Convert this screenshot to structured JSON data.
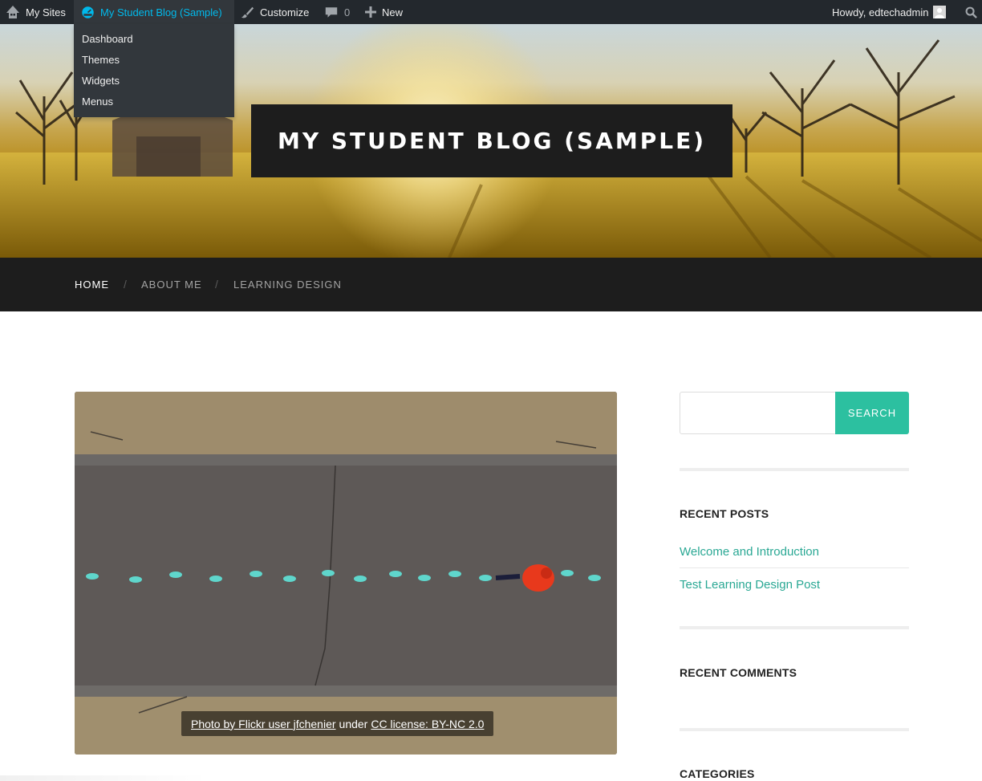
{
  "adminbar": {
    "my_sites": "My Sites",
    "site_name": "My Student Blog (Sample)",
    "customize": "Customize",
    "comments_count": "0",
    "new": "New",
    "howdy": "Howdy, edtechadmin",
    "dropdown": [
      "Dashboard",
      "Themes",
      "Widgets",
      "Menus"
    ],
    "active_color": "#00b9eb"
  },
  "header": {
    "site_title": "MY STUDENT BLOG (SAMPLE)"
  },
  "nav": {
    "items": [
      "HOME",
      "ABOUT ME",
      "LEARNING DESIGN"
    ],
    "separator": "/"
  },
  "post": {
    "caption": {
      "photo_link": "Photo by Flickr user jfchenier",
      "under": "under",
      "license_link": "CC license: BY-NC 2.0"
    }
  },
  "sidebar": {
    "search_button": "Search",
    "recent_posts_title": "RECENT POSTS",
    "recent_posts": [
      "Welcome and Introduction",
      "Test Learning Design Post"
    ],
    "recent_comments_title": "RECENT COMMENTS",
    "categories_title": "CATEGORIES",
    "accent_color": "#2cc0a0"
  }
}
